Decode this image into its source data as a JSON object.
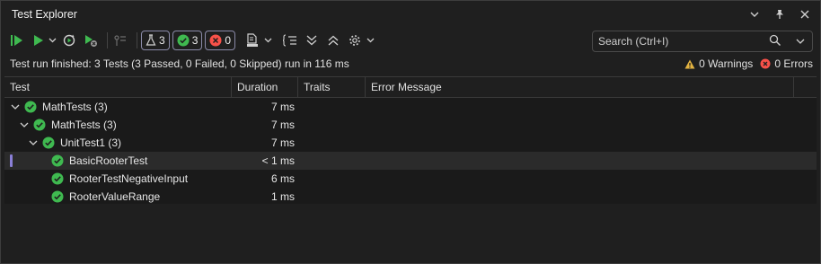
{
  "title": "Test Explorer",
  "counts": {
    "total": "3",
    "passed": "3",
    "failed": "0"
  },
  "search": {
    "placeholder": "Search (Ctrl+I)"
  },
  "status": {
    "text": "Test run finished: 3 Tests (3 Passed, 0 Failed, 0 Skipped) run in 116 ms",
    "warnings": "0 Warnings",
    "errors": "0 Errors"
  },
  "columns": {
    "test": "Test",
    "duration": "Duration",
    "traits": "Traits",
    "error": "Error Message"
  },
  "rows": [
    {
      "name": "MathTests  (3)",
      "duration": "7 ms"
    },
    {
      "name": "MathTests  (3)",
      "duration": "7 ms"
    },
    {
      "name": "UnitTest1  (3)",
      "duration": "7 ms"
    },
    {
      "name": "BasicRooterTest",
      "duration": "< 1 ms"
    },
    {
      "name": "RooterTestNegativeInput",
      "duration": "6 ms"
    },
    {
      "name": "RooterValueRange",
      "duration": "1 ms"
    }
  ],
  "colors": {
    "pass": "#3fb950",
    "fail": "#f85149",
    "warn": "#e3b341",
    "accent": "#8a7fd6"
  }
}
